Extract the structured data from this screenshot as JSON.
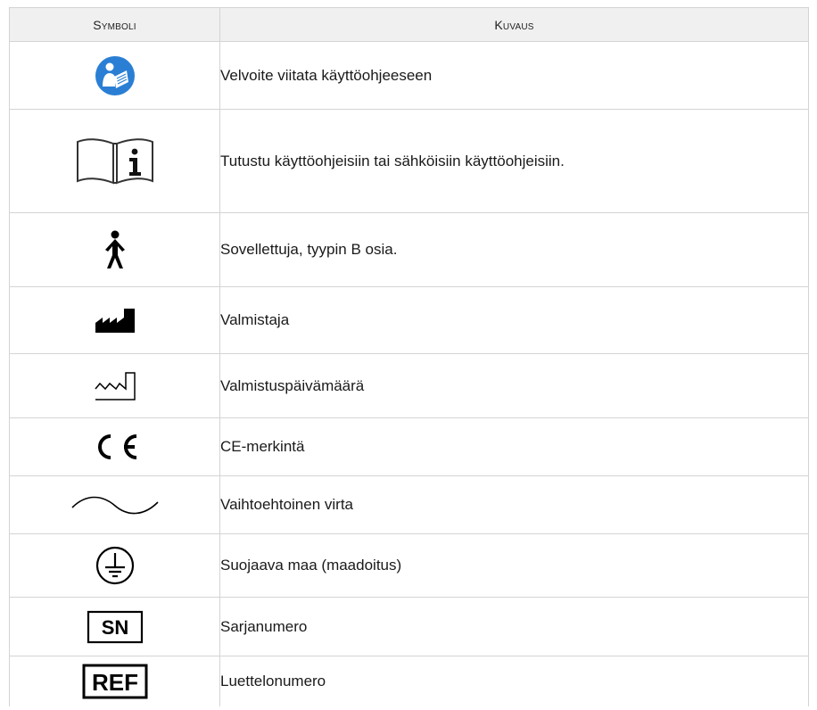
{
  "table": {
    "headers": {
      "symbol": "Symboli",
      "description": "Kuvaus"
    },
    "rows": [
      {
        "icon": "read-instructions-mandatory-icon",
        "description": "Velvoite viitata käyttöohjeeseen"
      },
      {
        "icon": "consult-instructions-icon",
        "description": "Tutustu käyttöohjeisiin tai sähköisiin käyttöohjeisiin."
      },
      {
        "icon": "type-b-applied-part-icon",
        "description": "Sovellettuja, tyypin B osia."
      },
      {
        "icon": "manufacturer-icon",
        "description": "Valmistaja"
      },
      {
        "icon": "date-of-manufacture-icon",
        "description": "Valmistuspäivämäärä"
      },
      {
        "icon": "ce-mark-icon",
        "description": "CE-merkintä"
      },
      {
        "icon": "alternating-current-icon",
        "description": "Vaihtoehtoinen virta"
      },
      {
        "icon": "protective-earth-icon",
        "description": "Suojaava maa (maadoitus)"
      },
      {
        "icon": "serial-number-icon",
        "label": "SN",
        "description": "Sarjanumero"
      },
      {
        "icon": "catalogue-number-icon",
        "label": "REF",
        "description": "Luettelonumero"
      }
    ]
  },
  "colors": {
    "mandatory_blue": "#2a7fd4",
    "header_bg": "#f0f0f0",
    "grid": "#d4d4d4"
  }
}
